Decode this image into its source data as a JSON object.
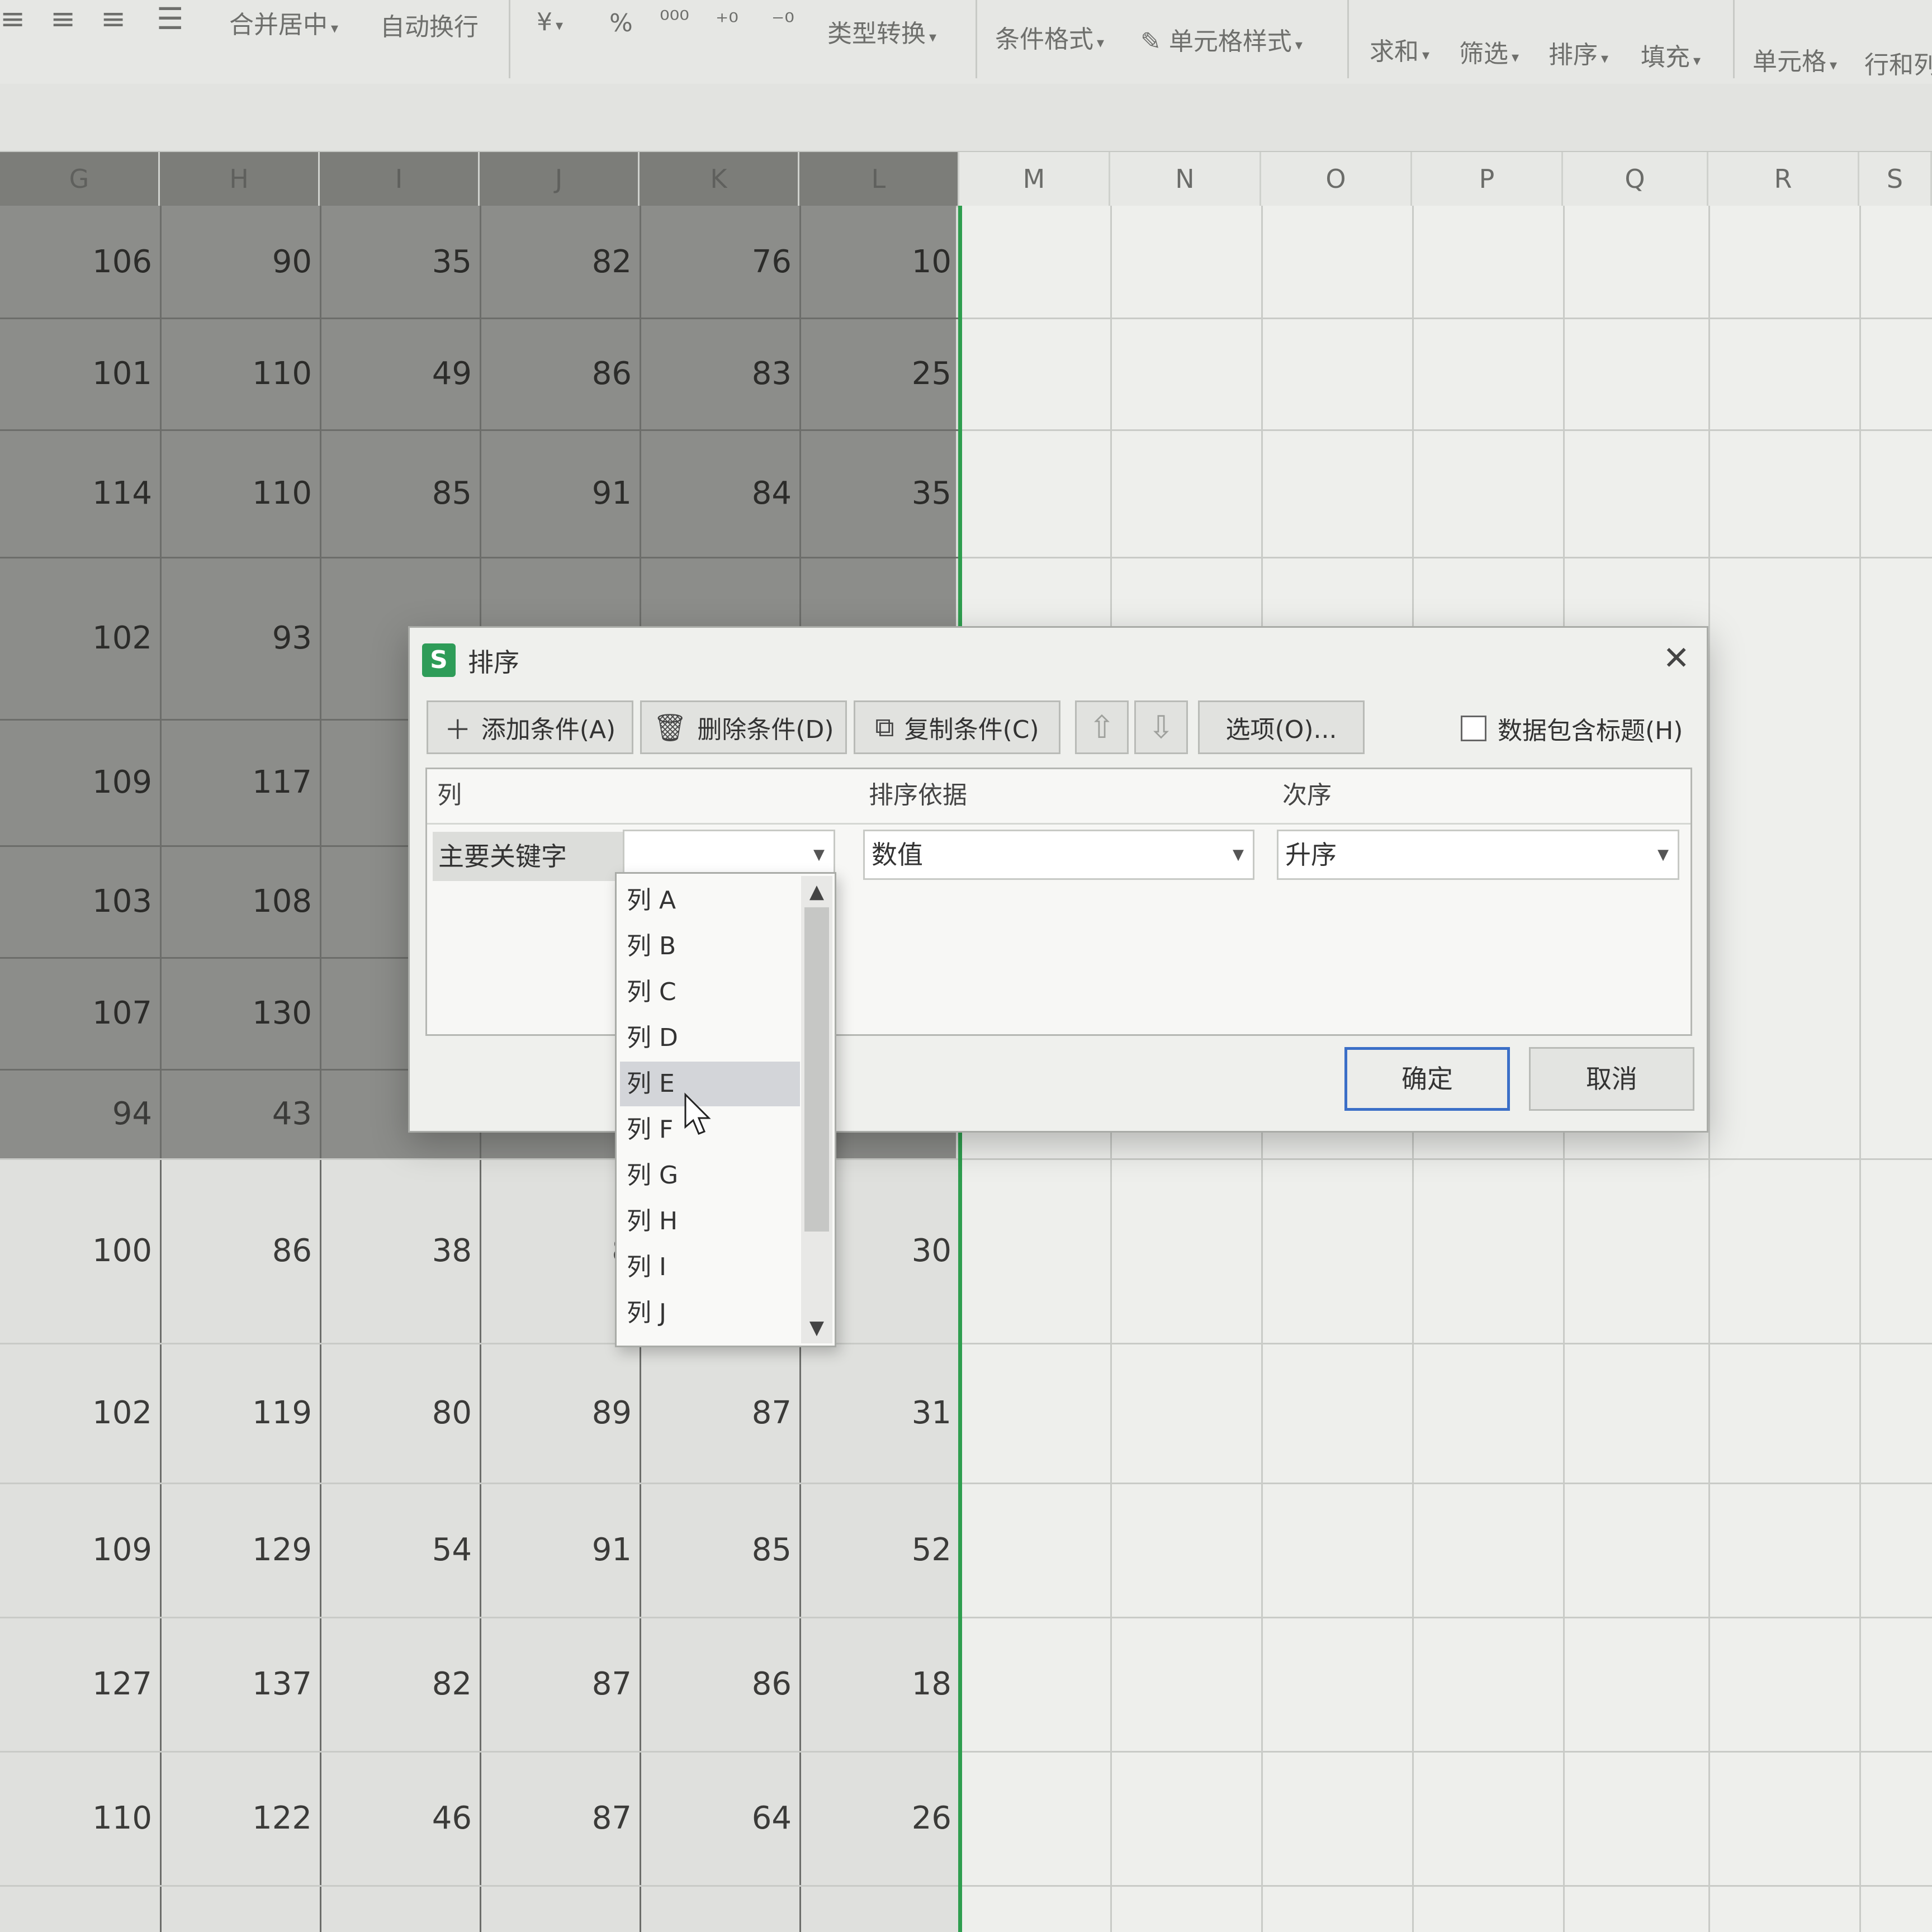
{
  "ribbon": {
    "merge_center": "合并居中",
    "wrap_text": "自动换行",
    "currency": "¥",
    "percent": "%",
    "type_convert": "类型转换",
    "cond_format": "条件格式",
    "cell_style": "单元格样式",
    "sum": "求和",
    "filter": "筛选",
    "sort": "排序",
    "fill": "填充",
    "cells": "单元格",
    "rows_cols": "行和列"
  },
  "columns": {
    "selected": [
      "G",
      "H",
      "I",
      "J",
      "K",
      "L"
    ],
    "unselected": [
      "M",
      "N",
      "O",
      "P",
      "Q",
      "R",
      "S"
    ]
  },
  "rows": [
    [
      "106",
      "90",
      "35",
      "82",
      "76",
      "10"
    ],
    [
      "101",
      "110",
      "49",
      "86",
      "83",
      "25"
    ],
    [
      "114",
      "110",
      "85",
      "91",
      "84",
      "35"
    ],
    [
      "102",
      "93",
      "",
      "",
      "",
      ""
    ],
    [
      "109",
      "117",
      "",
      "",
      "",
      ""
    ],
    [
      "103",
      "108",
      "",
      "",
      "",
      ""
    ],
    [
      "107",
      "130",
      "",
      "",
      "",
      ""
    ],
    [
      "94",
      "43",
      "",
      "",
      "",
      ""
    ],
    [
      "100",
      "86",
      "38",
      "8",
      "",
      "30"
    ],
    [
      "102",
      "119",
      "80",
      "89",
      "87",
      "31"
    ],
    [
      "109",
      "129",
      "54",
      "91",
      "85",
      "52"
    ],
    [
      "127",
      "137",
      "82",
      "87",
      "86",
      "18"
    ],
    [
      "110",
      "122",
      "46",
      "87",
      "64",
      "26"
    ]
  ],
  "dialog": {
    "title": "排序",
    "close": "✕",
    "add_condition": "添加条件(A)",
    "delete_condition": "删除条件(D)",
    "copy_condition": "复制条件(C)",
    "move_up": "⇧",
    "move_down": "⇩",
    "options": "选项(O)...",
    "header_checkbox_label": "数据包含标题(H)",
    "col_header_column": "列",
    "col_header_sort_on": "排序依据",
    "col_header_order": "次序",
    "primary_key_label": "主要关键字",
    "primary_key_value": "",
    "sort_on_value": "数值",
    "order_value": "升序",
    "ok": "确定",
    "cancel": "取消"
  },
  "dropdown": {
    "items": [
      "列 A",
      "列 B",
      "列 C",
      "列 D",
      "列 E",
      "列 F",
      "列 G",
      "列 H",
      "列 I",
      "列 J"
    ],
    "highlighted": "列 E"
  },
  "colors": {
    "selection_dim": "#8c8d8a",
    "accent_green": "#2f9e4f",
    "ok_border": "#3b6fc7"
  }
}
